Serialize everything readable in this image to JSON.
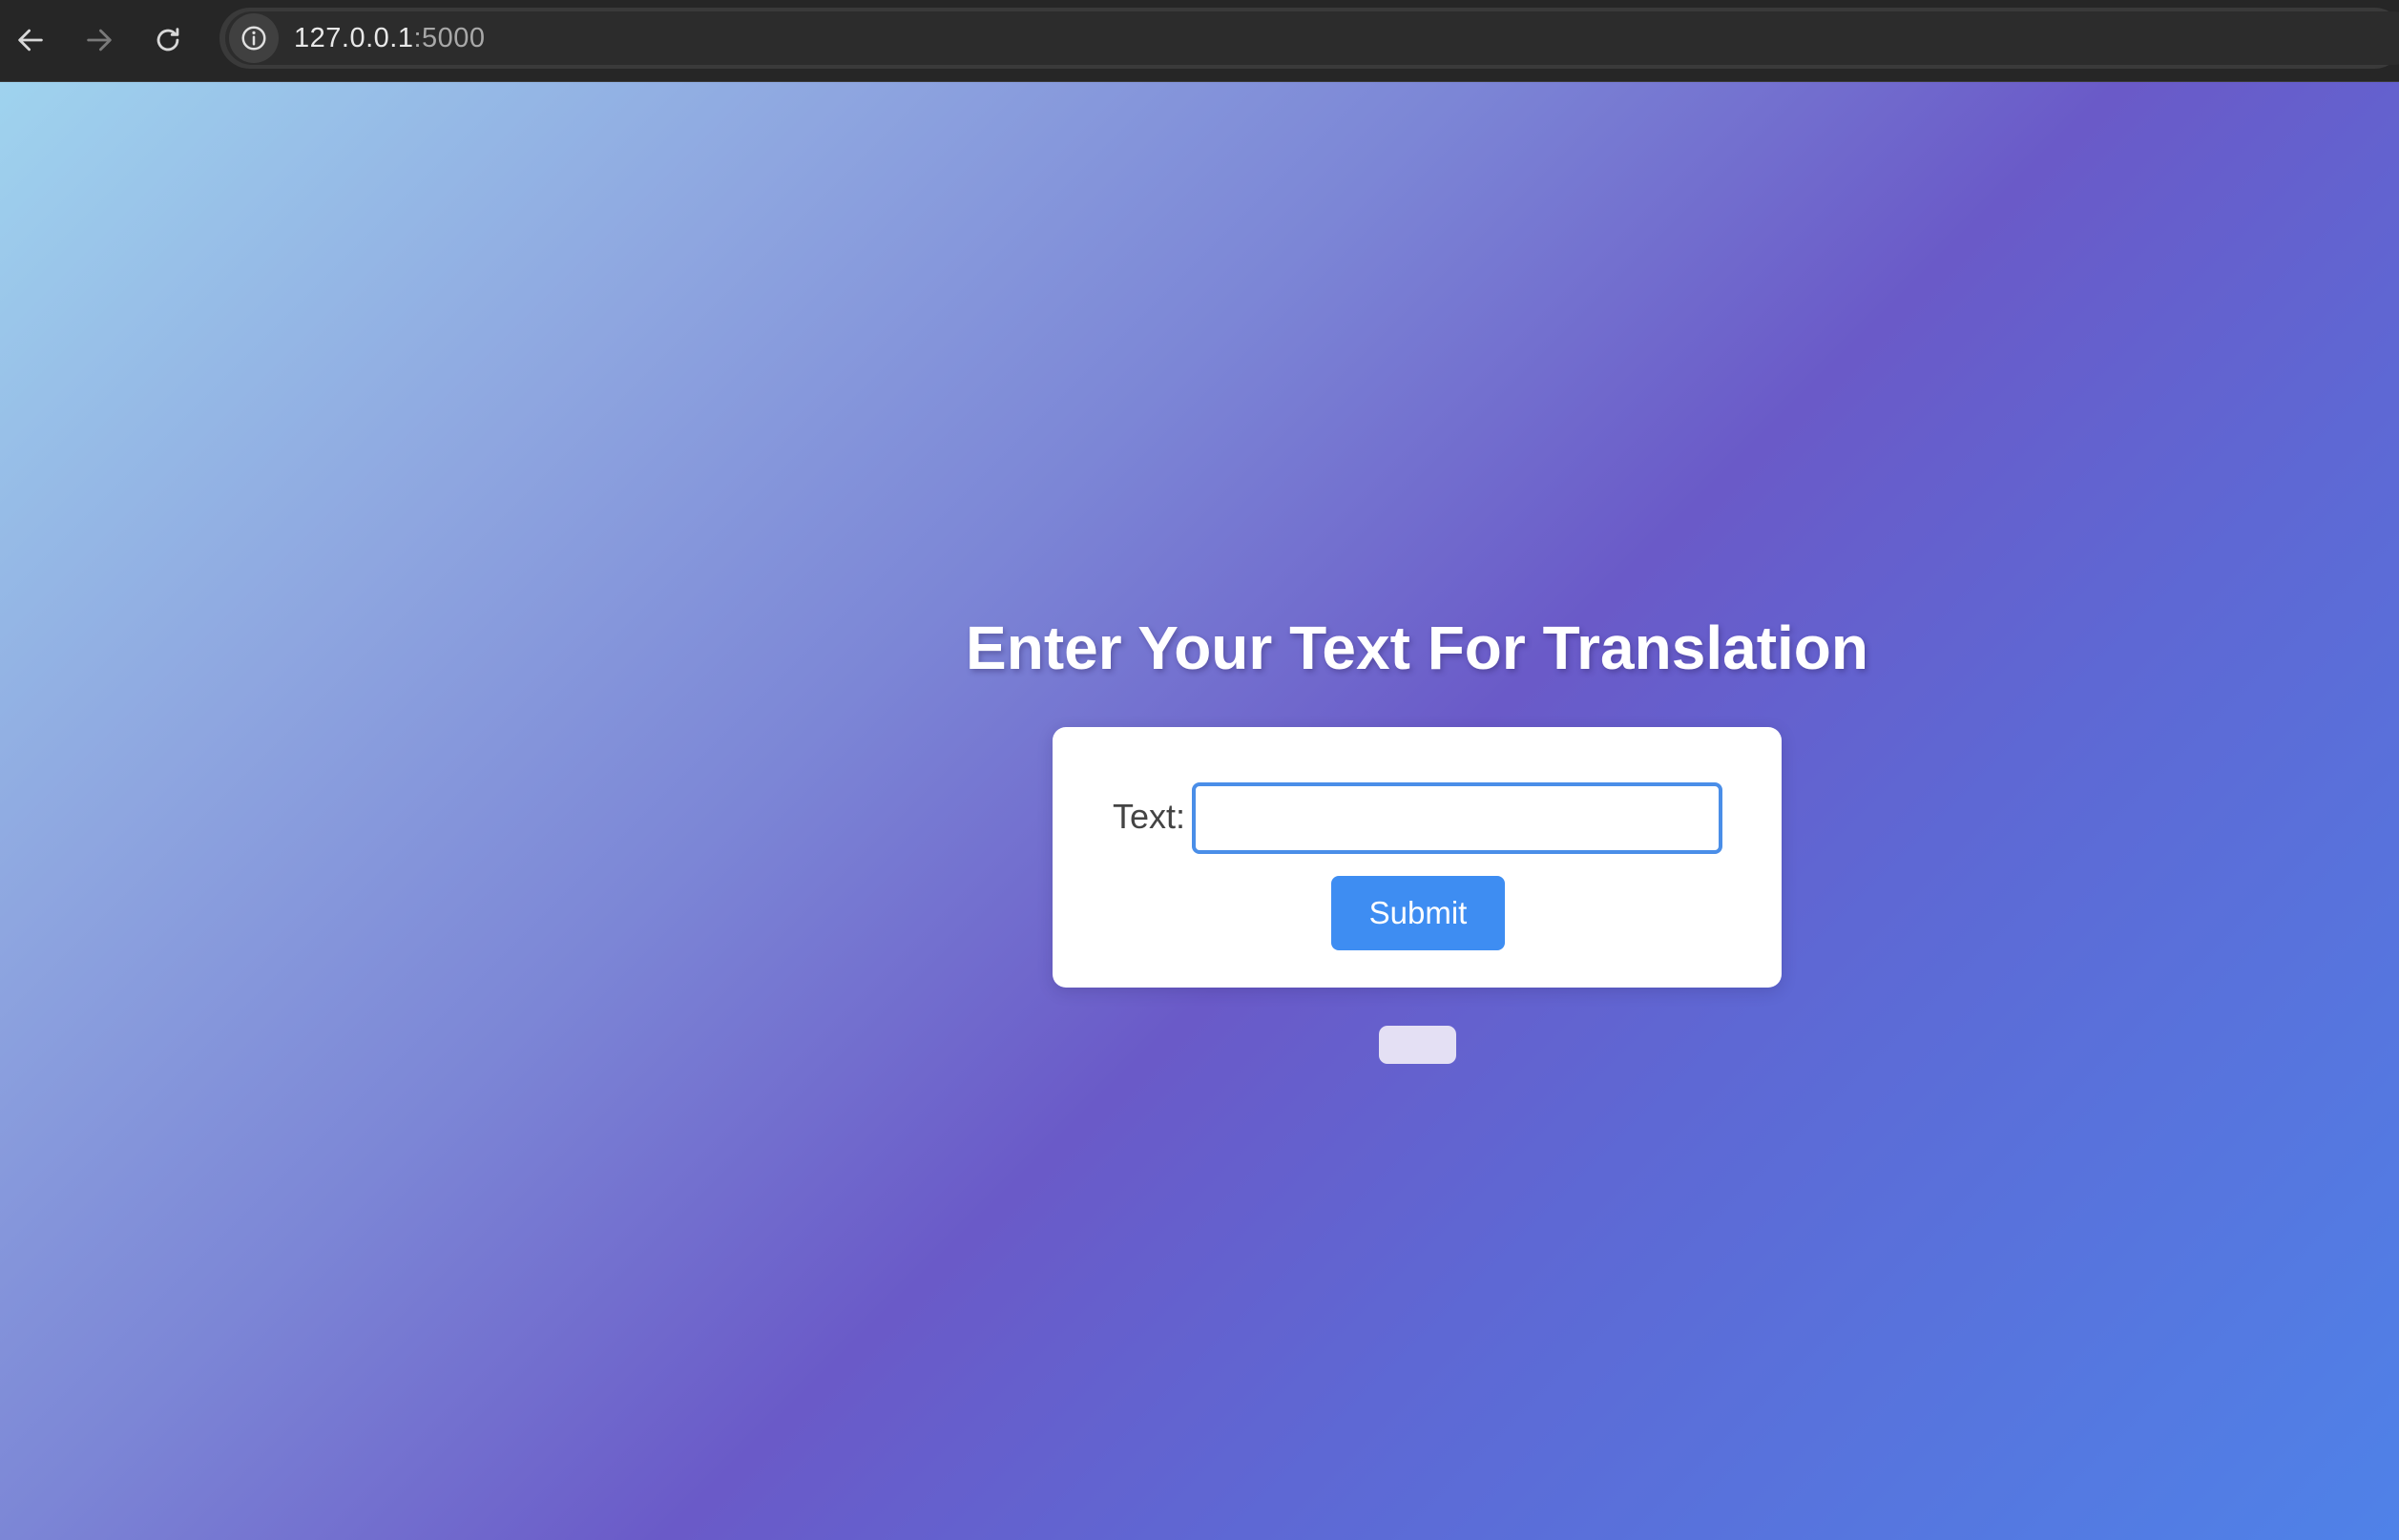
{
  "browser": {
    "url_host": "127.0.0.1",
    "url_port": ":5000",
    "icons": {
      "back": "arrow-left-icon",
      "forward": "arrow-right-icon",
      "reload": "reload-icon",
      "site_info": "info-icon"
    }
  },
  "page": {
    "title": "Enter Your Text For Translation",
    "form": {
      "label": "Text:",
      "input_value": "",
      "submit_label": "Submit"
    },
    "result": ""
  },
  "colors": {
    "accent": "#3e8df2",
    "input_border": "#4a8ee8",
    "gradient_start": "#9fd3ee",
    "gradient_mid": "#6a5ac8",
    "gradient_end": "#4f82e8"
  }
}
